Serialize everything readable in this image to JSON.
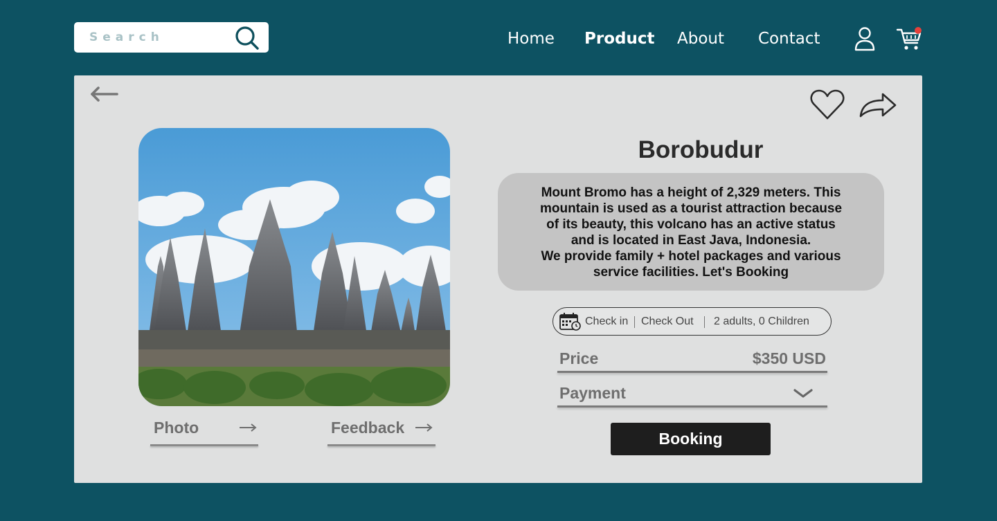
{
  "search": {
    "placeholder": "Search"
  },
  "nav": {
    "home": "Home",
    "product": "Product",
    "about": "About",
    "contact": "Contact",
    "active": "Product"
  },
  "cart": {
    "has_notification": true,
    "badge_color": "#e5413b"
  },
  "colors": {
    "background": "#0d5262",
    "card": "#dfe0e0",
    "description_box": "#c4c4c4",
    "button": "#1e1e1e"
  },
  "product": {
    "title": "Borobudur",
    "description_lines": [
      "Mount Bromo has a height of 2,329 meters. This",
      "mountain is used as a tourist attraction because",
      "of its beauty, this volcano has an active status",
      "and is located in East Java, Indonesia.",
      "We provide family + hotel packages and various",
      "service facilities. Let's Booking"
    ],
    "image_alt": "temple photo"
  },
  "tabs": {
    "photo": "Photo",
    "feedback": "Feedback"
  },
  "booking": {
    "check_in": "Check in",
    "check_out": "Check Out",
    "guests": "2 adults, 0 Children",
    "price_label": "Price",
    "price_value": "$350 USD",
    "payment_label": "Payment",
    "button_label": "Booking"
  },
  "icons": [
    "search-icon",
    "user-icon",
    "cart-icon",
    "back-arrow-icon",
    "heart-icon",
    "share-icon",
    "calendar-icon",
    "chevron-down-icon",
    "arrow-right-icon"
  ]
}
